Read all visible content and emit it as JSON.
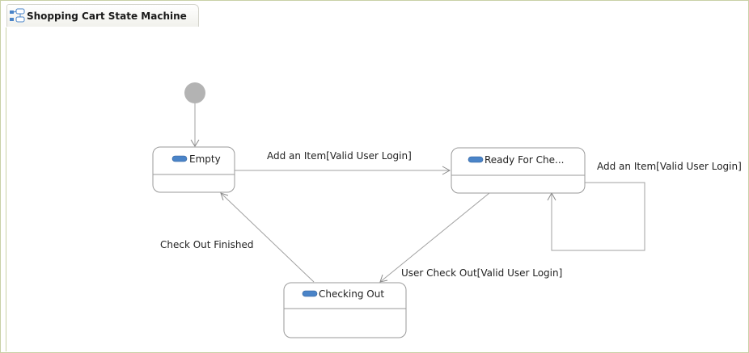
{
  "diagram": {
    "title": "Shopping Cart State Machine",
    "title_icon": "state-machine-icon",
    "colors": {
      "frame_border": "#c9d1a6",
      "state_border": "#9a9a9a",
      "edge": "#a0a0a0",
      "initial_node": "#b3b3b3",
      "state_icon": "#4a84c8"
    },
    "states": {
      "empty": {
        "label": "Empty",
        "icon": "state-icon"
      },
      "ready": {
        "label": "Ready For Che...",
        "icon": "state-icon"
      },
      "checking_out": {
        "label": "Checking Out",
        "icon": "state-icon"
      }
    },
    "transitions": {
      "add_item": {
        "label": "Add an Item[Valid User Login]"
      },
      "add_item_self": {
        "label": "Add an Item[Valid User Login]"
      },
      "user_check_out": {
        "label": "User Check Out[Valid User Login]"
      },
      "check_out_finished": {
        "label": "Check Out Finished"
      }
    }
  }
}
